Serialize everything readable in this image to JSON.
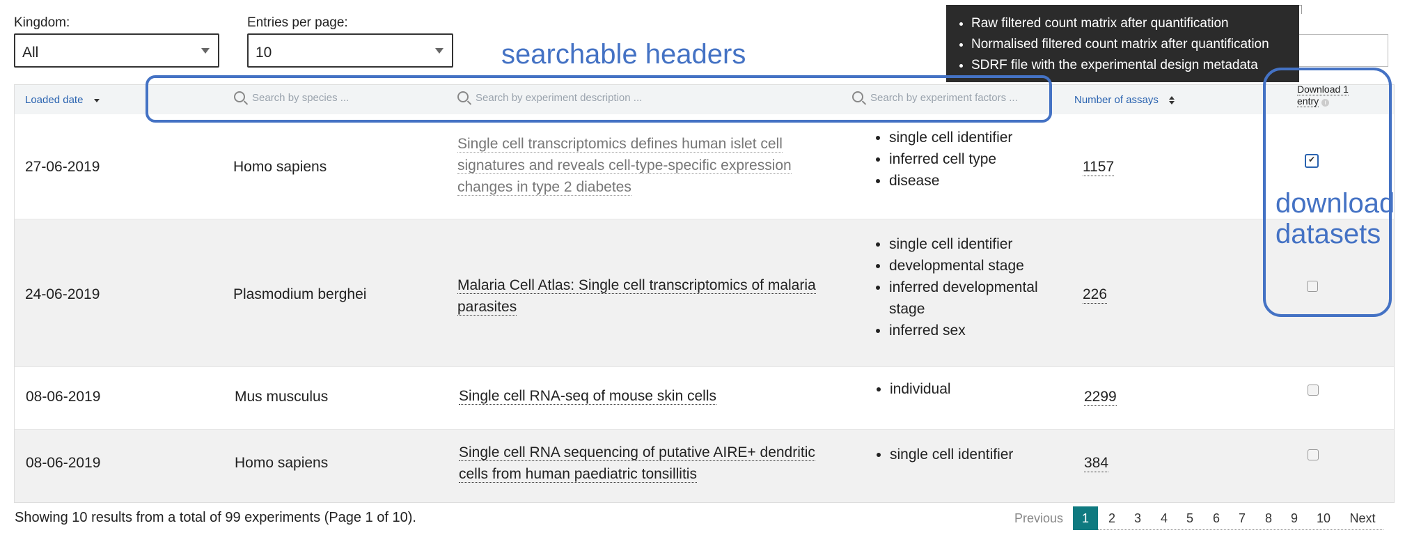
{
  "controls": {
    "kingdom_label": "Kingdom:",
    "kingdom_value": "All",
    "entries_label": "Entries per page:",
    "entries_value": "10"
  },
  "headers": {
    "loaded_date": "Loaded date",
    "species_placeholder": "Search by species ...",
    "description_placeholder": "Search by experiment description ...",
    "factors_placeholder": "Search by experiment factors ...",
    "assays": "Number of assays",
    "download": "Download 1 entry",
    "hidden_assays_header": "Number of assays"
  },
  "tooltip": {
    "items": [
      "Raw filtered count matrix after quantification",
      "Normalised filtered count matrix after quantification",
      "SDRF file with the experimental design metadata"
    ]
  },
  "annotations": {
    "searchable_headers": "searchable headers",
    "download_line1": "download",
    "download_line2": "datasets"
  },
  "rows": [
    {
      "date": "27-06-2019",
      "species": "Homo sapiens",
      "description_lines": [
        "Single cell transcriptomics defines human islet cell",
        "signatures and reveals cell-type-specific expression",
        "changes in type 2 diabetes"
      ],
      "factors": [
        "single cell identifier",
        "inferred cell type",
        "disease"
      ],
      "assays": "1157",
      "checked": true
    },
    {
      "date": "24-06-2019",
      "species": "Plasmodium berghei",
      "description_lines": [
        "Malaria Cell Atlas: Single cell transcriptomics of malaria",
        "parasites"
      ],
      "factors": [
        "single cell identifier",
        "developmental stage",
        "inferred developmental stage",
        "inferred sex"
      ],
      "assays": "226",
      "checked": false
    },
    {
      "date": "08-06-2019",
      "species": "Mus musculus",
      "description_lines": [
        "Single cell RNA-seq of mouse skin cells"
      ],
      "factors": [
        "individual"
      ],
      "assays": "2299",
      "checked": false
    },
    {
      "date": "08-06-2019",
      "species": "Homo sapiens",
      "description_lines": [
        "Single cell RNA sequencing of putative AIRE+ dendritic",
        "cells from human paediatric tonsillitis"
      ],
      "factors": [
        "single cell identifier"
      ],
      "assays": "384",
      "checked": false
    }
  ],
  "footer": {
    "summary": "Showing 10 results from a total of 99 experiments (Page 1 of 10).",
    "previous": "Previous",
    "pages": [
      "1",
      "2",
      "3",
      "4",
      "5",
      "6",
      "7",
      "8",
      "9",
      "10"
    ],
    "current_page": "1",
    "next": "Next"
  },
  "colors": {
    "annotation": "#4472c4",
    "header_link": "#2a63b0",
    "pager_active": "#0f7a80",
    "tooltip_bg": "#2b2b2b"
  }
}
